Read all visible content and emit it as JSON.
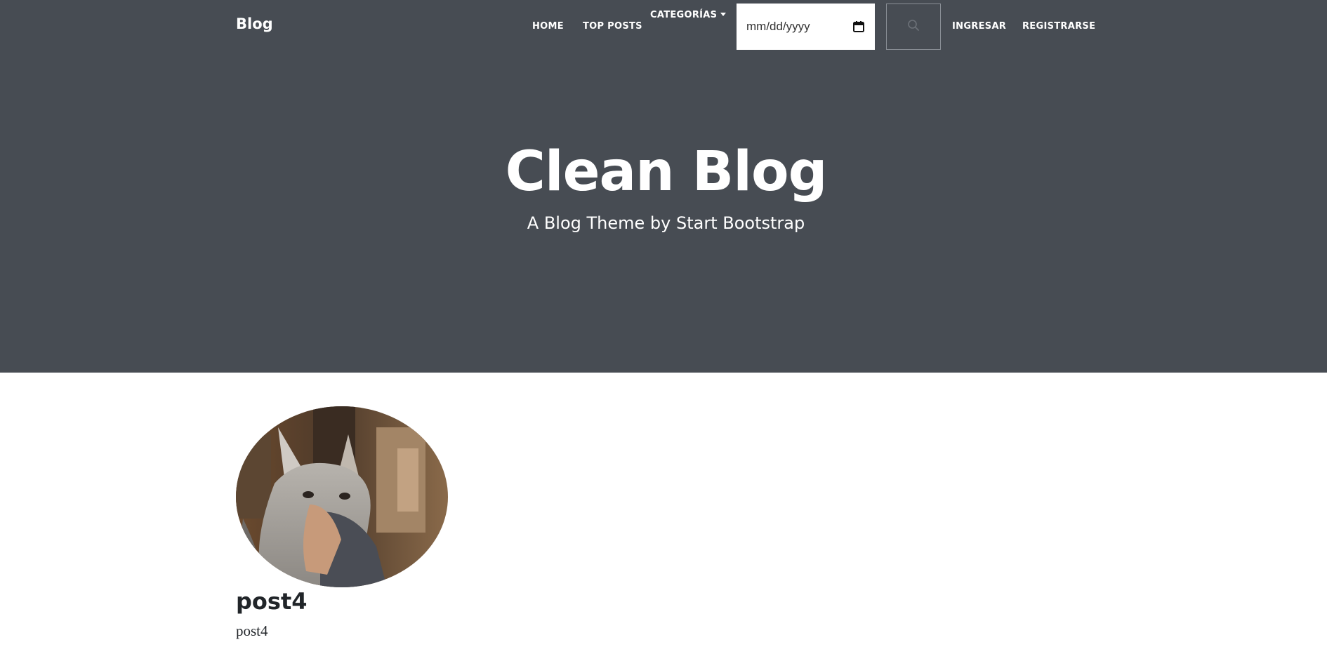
{
  "navbar": {
    "brand": "Blog",
    "links": {
      "home": "HOME",
      "top_posts": "TOP POSTS",
      "categories": "CATEGORÍAS",
      "login": "INGRESAR",
      "register": "REGISTRARSE"
    },
    "date_input": {
      "placeholder": "mm/dd/yyyy",
      "icon": "calendar-icon"
    },
    "search": {
      "icon": "search-icon"
    }
  },
  "hero": {
    "title": "Clean Blog",
    "subtitle": "A Blog Theme by Start Bootstrap",
    "background_color": "#474c53"
  },
  "posts": [
    {
      "title": "post4",
      "subtitle": "post4"
    }
  ]
}
